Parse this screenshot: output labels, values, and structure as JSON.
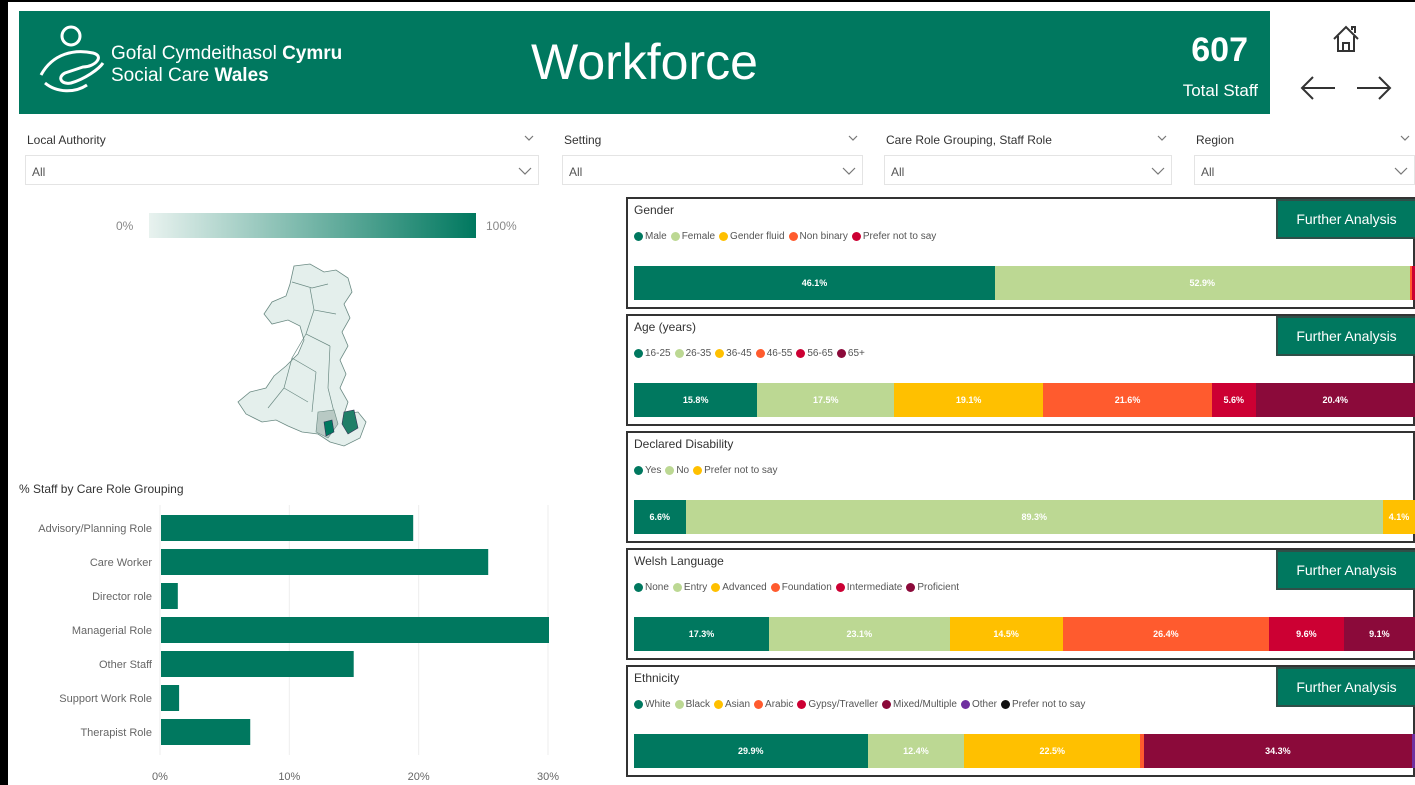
{
  "header": {
    "org_line1_regular": "Gofal Cymdeithasol ",
    "org_line1_bold": "Cymru",
    "org_line2_regular": "Social Care ",
    "org_line2_bold": "Wales",
    "title": "Workforce",
    "total_count": "607",
    "total_label": "Total Staff",
    "bg_color": "#00785f"
  },
  "nav": {
    "home_icon": "home-icon",
    "back_icon": "arrow-left-icon",
    "forward_icon": "arrow-right-icon"
  },
  "filters": [
    {
      "label": "Local Authority",
      "value": "All"
    },
    {
      "label": "Setting",
      "value": "All"
    },
    {
      "label": "Care Role Grouping, Staff Role",
      "value": "All"
    },
    {
      "label": "Region",
      "value": "All"
    }
  ],
  "map_legend": {
    "low": "0%",
    "high": "100%"
  },
  "role_chart": {
    "title": "% Staff by Care Role Grouping",
    "chart_data": {
      "type": "bar",
      "orientation": "horizontal",
      "categories": [
        "Advisory/Planning Role",
        "Care Worker",
        "Director role",
        "Managerial Role",
        "Other Staff",
        "Support Work Role",
        "Therapist Role"
      ],
      "values": [
        19.5,
        25.3,
        1.3,
        30.1,
        14.9,
        1.4,
        6.9
      ],
      "xlim": [
        0,
        30
      ],
      "xticks": [
        "0%",
        "10%",
        "20%",
        "30%"
      ],
      "color": "#00785f",
      "grid": true
    }
  },
  "panels": [
    {
      "title": "Gender",
      "button": "Further Analysis",
      "legend": [
        {
          "name": "Male",
          "color": "#00785f"
        },
        {
          "name": "Female",
          "color": "#bcd893"
        },
        {
          "name": "Gender fluid",
          "color": "#ffc000"
        },
        {
          "name": "Non binary",
          "color": "#ff5b2e"
        },
        {
          "name": "Prefer not to say",
          "color": "#cc0033"
        }
      ],
      "segments": [
        {
          "value": 46.1,
          "label": "46.1%",
          "color": "#00785f"
        },
        {
          "value": 52.9,
          "label": "52.9%",
          "color": "#bcd893"
        },
        {
          "value": 0.3,
          "label": "",
          "color": "#ff5b2e"
        },
        {
          "value": 0.4,
          "label": "",
          "color": "#cc0033"
        }
      ]
    },
    {
      "title": "Age (years)",
      "button": "Further Analysis",
      "legend": [
        {
          "name": "16-25",
          "color": "#00785f"
        },
        {
          "name": "26-35",
          "color": "#bcd893"
        },
        {
          "name": "36-45",
          "color": "#ffc000"
        },
        {
          "name": "46-55",
          "color": "#ff5b2e"
        },
        {
          "name": "56-65",
          "color": "#cc0033"
        },
        {
          "name": "65+",
          "color": "#8b0a3a"
        }
      ],
      "segments": [
        {
          "value": 15.8,
          "label": "15.8%",
          "color": "#00785f"
        },
        {
          "value": 17.5,
          "label": "17.5%",
          "color": "#bcd893"
        },
        {
          "value": 19.1,
          "label": "19.1%",
          "color": "#ffc000"
        },
        {
          "value": 21.6,
          "label": "21.6%",
          "color": "#ff5b2e"
        },
        {
          "value": 5.6,
          "label": "5.6%",
          "color": "#cc0033"
        },
        {
          "value": 20.4,
          "label": "20.4%",
          "color": "#8b0a3a"
        }
      ]
    },
    {
      "title": "Declared Disability",
      "button": "",
      "legend": [
        {
          "name": "Yes",
          "color": "#00785f"
        },
        {
          "name": "No",
          "color": "#bcd893"
        },
        {
          "name": "Prefer not to say",
          "color": "#ffc000"
        }
      ],
      "segments": [
        {
          "value": 6.6,
          "label": "6.6%",
          "color": "#00785f"
        },
        {
          "value": 89.3,
          "label": "89.3%",
          "color": "#bcd893"
        },
        {
          "value": 4.1,
          "label": "4.1%",
          "color": "#ffc000"
        }
      ]
    },
    {
      "title": "Welsh Language",
      "button": "Further Analysis",
      "legend": [
        {
          "name": "None",
          "color": "#00785f"
        },
        {
          "name": "Entry",
          "color": "#bcd893"
        },
        {
          "name": "Advanced",
          "color": "#ffc000"
        },
        {
          "name": "Foundation",
          "color": "#ff5b2e"
        },
        {
          "name": "Intermediate",
          "color": "#cc0033"
        },
        {
          "name": "Proficient",
          "color": "#8b0a3a"
        }
      ],
      "segments": [
        {
          "value": 17.3,
          "label": "17.3%",
          "color": "#00785f"
        },
        {
          "value": 23.1,
          "label": "23.1%",
          "color": "#bcd893"
        },
        {
          "value": 14.5,
          "label": "14.5%",
          "color": "#ffc000"
        },
        {
          "value": 26.4,
          "label": "26.4%",
          "color": "#ff5b2e"
        },
        {
          "value": 9.6,
          "label": "9.6%",
          "color": "#cc0033"
        },
        {
          "value": 9.1,
          "label": "9.1%",
          "color": "#8b0a3a"
        }
      ]
    },
    {
      "title": "Ethnicity",
      "button": "Further Analysis",
      "legend": [
        {
          "name": "White",
          "color": "#00785f"
        },
        {
          "name": "Black",
          "color": "#bcd893"
        },
        {
          "name": "Asian",
          "color": "#ffc000"
        },
        {
          "name": "Arabic",
          "color": "#ff5b2e"
        },
        {
          "name": "Gypsy/Traveller",
          "color": "#cc0033"
        },
        {
          "name": "Mixed/Multiple",
          "color": "#8b0a3a"
        },
        {
          "name": "Other",
          "color": "#7030a0"
        },
        {
          "name": "Prefer not to say",
          "color": "#111111"
        }
      ],
      "segments": [
        {
          "value": 29.9,
          "label": "29.9%",
          "color": "#00785f"
        },
        {
          "value": 12.4,
          "label": "12.4%",
          "color": "#bcd893"
        },
        {
          "value": 22.5,
          "label": "22.5%",
          "color": "#ffc000"
        },
        {
          "value": 0.5,
          "label": "",
          "color": "#ff5b2e"
        },
        {
          "value": 34.3,
          "label": "34.3%",
          "color": "#8b0a3a"
        },
        {
          "value": 0.4,
          "label": "",
          "color": "#7030a0"
        }
      ]
    }
  ]
}
